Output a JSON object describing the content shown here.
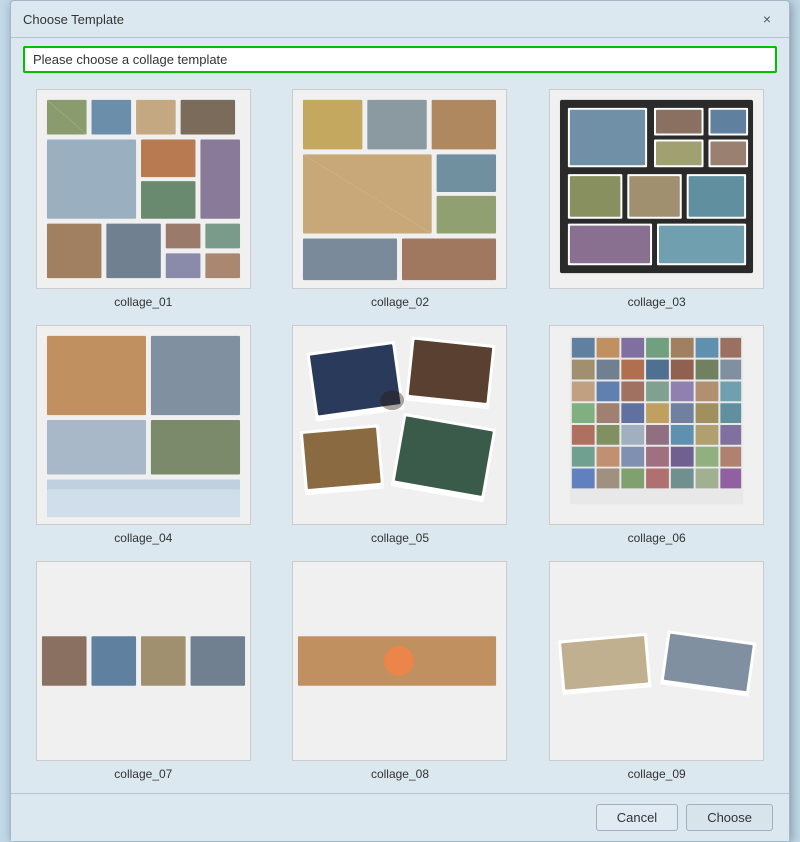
{
  "dialog": {
    "title": "Choose Template",
    "prompt": "Please choose a collage template",
    "close_label": "×"
  },
  "templates": [
    {
      "id": "collage_01",
      "label": "collage_01"
    },
    {
      "id": "collage_02",
      "label": "collage_02"
    },
    {
      "id": "collage_03",
      "label": "collage_03"
    },
    {
      "id": "collage_04",
      "label": "collage_04"
    },
    {
      "id": "collage_05",
      "label": "collage_05"
    },
    {
      "id": "collage_06",
      "label": "collage_06"
    },
    {
      "id": "collage_07",
      "label": "collage_07"
    },
    {
      "id": "collage_08",
      "label": "collage_08"
    },
    {
      "id": "collage_09",
      "label": "collage_09"
    }
  ],
  "footer": {
    "cancel_label": "Cancel",
    "choose_label": "Choose"
  }
}
